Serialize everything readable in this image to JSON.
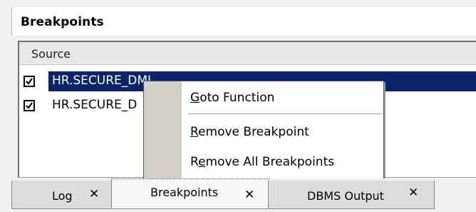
{
  "panel": {
    "title": "Breakpoints"
  },
  "list": {
    "column_header": "Source",
    "rows": [
      {
        "text": "HR.SECURE_DML",
        "checked": true,
        "selected": true
      },
      {
        "text": "HR.SECURE_D",
        "checked": true,
        "selected": false
      }
    ]
  },
  "context_menu": {
    "items": [
      {
        "pre": "",
        "key": "G",
        "post": "oto Function"
      },
      {
        "pre": "",
        "key": "R",
        "post": "emove Breakpoint"
      },
      {
        "pre": "R",
        "key": "e",
        "post": "move All Breakpoints"
      }
    ]
  },
  "tabs": [
    {
      "label": "Log",
      "close": "✕",
      "active": false
    },
    {
      "label": "Breakpoints",
      "close": "✕",
      "active": true
    },
    {
      "label": "DBMS Output",
      "close": "✕",
      "active": false
    }
  ],
  "colors": {
    "selection": "#0a246a",
    "menu_gutter": "#d4d0c8"
  }
}
